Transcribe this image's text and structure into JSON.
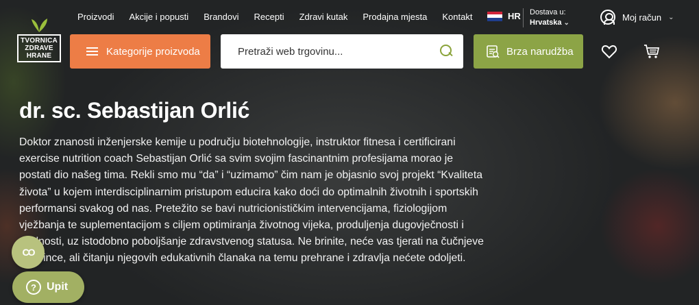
{
  "brand": {
    "logo_lines": [
      "TVORNICA",
      "ZDRAVE",
      "HRANE"
    ]
  },
  "nav": {
    "items": [
      "Proizvodi",
      "Akcije i popusti",
      "Brandovi",
      "Recepti",
      "Zdravi kutak",
      "Prodajna mjesta",
      "Kontakt"
    ]
  },
  "lang": {
    "code": "HR",
    "flag_icon": "croatia-flag-icon"
  },
  "delivery": {
    "label": "Dostava u:",
    "destination": "Hrvatska"
  },
  "account": {
    "label": "Moj račun"
  },
  "category_button": {
    "label": "Kategorije proizvoda"
  },
  "search": {
    "placeholder": "Pretraži web trgovinu..."
  },
  "quick_order": {
    "label": "Brza narudžba"
  },
  "icons": {
    "wishlist": "heart-icon",
    "cart": "cart-icon",
    "search": "search-icon",
    "account": "user-icon"
  },
  "profile": {
    "name": "dr. sc. Sebastijan Orlić",
    "bio": "Doktor znanosti inženjerske kemije u području biotehnologije, instruktor fitnesa i certificirani exercise nutrition coach Sebastijan Orlić sa svim svojim fascinantnim profesijama morao je postati dio našeg tima. Rekli smo mu “da” i “uzimamo” čim nam je objasnio svoj projekt “Kvaliteta života” u kojem interdisciplinarnim pristupom educira kako doći do optimalnih životnih i sportskih performansi svakog od nas. Pretežito se bavi nutricionističkim intervencijama, fiziologijom vježbanja te suplementacijom s ciljem optimiranja životnog vijeka, produljenja dugovječnosti i vitalnosti, uz istodobno poboljšanje zdravstvenog statusa. Ne brinite, neće vas tjerati na čučnjeve i marince, ali čitanju njegovih edukativnih članaka na temu prehrane i zdravlja nećete odoljeti."
  },
  "floating": {
    "upit_label": "Upit",
    "accent_colors": {
      "orange": "#ed7d46",
      "green": "#8ca446",
      "sage": "#b8c27e"
    }
  }
}
